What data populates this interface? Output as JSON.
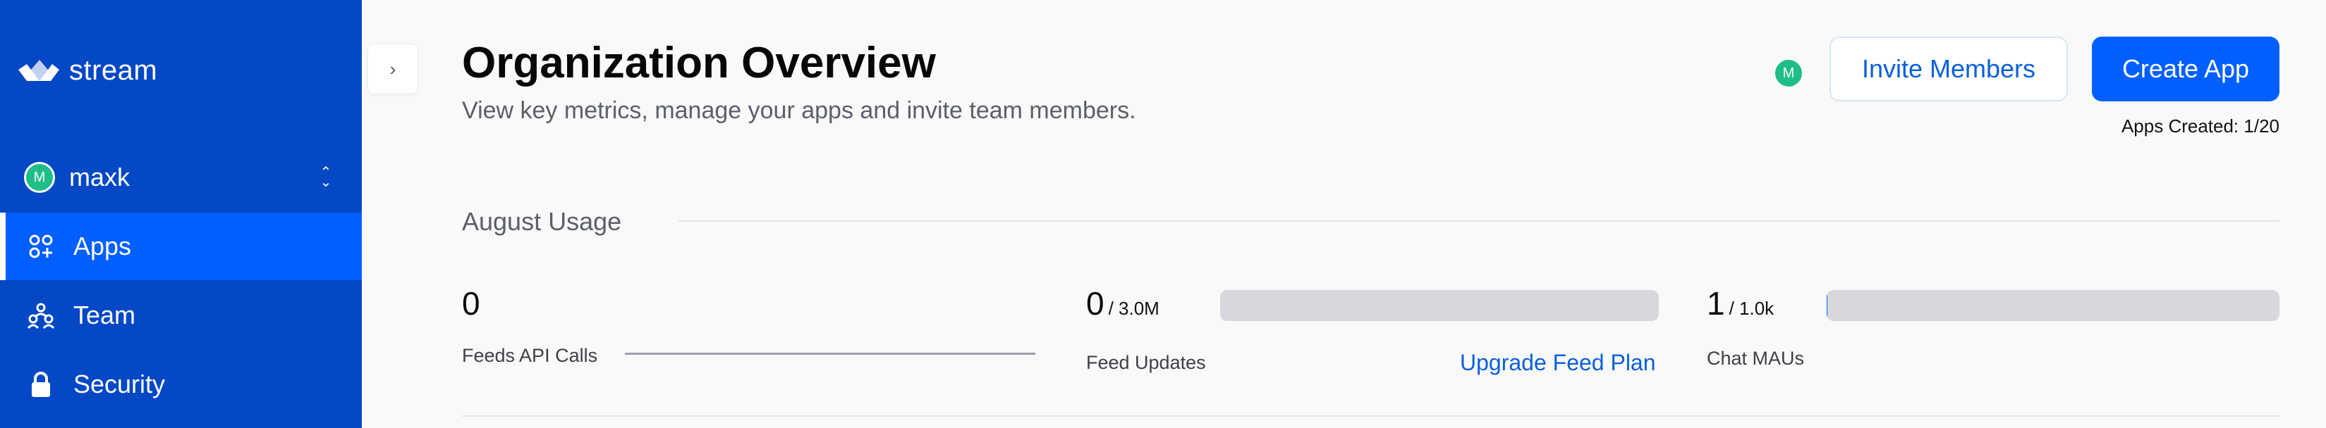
{
  "sidebar": {
    "brand": "stream",
    "org": {
      "initial": "M",
      "name": "maxk"
    },
    "items": [
      {
        "label": "Apps",
        "icon": "apps-icon",
        "active": true
      },
      {
        "label": "Team",
        "icon": "team-icon",
        "active": false
      },
      {
        "label": "Security",
        "icon": "lock-icon",
        "active": false
      }
    ]
  },
  "header": {
    "title": "Organization Overview",
    "subtitle": "View key metrics, manage your apps and invite team members.",
    "user_initial": "M",
    "invite_label": "Invite Members",
    "create_label": "Create App",
    "apps_created": "Apps Created: 1/20"
  },
  "usage": {
    "title": "August Usage",
    "metrics": [
      {
        "value": "0",
        "limit": "",
        "label": "Feeds API Calls"
      },
      {
        "value": "0",
        "limit": "/ 3.0M",
        "label": "Feed Updates",
        "fill": 0,
        "link": "Upgrade Feed Plan"
      },
      {
        "value": "1",
        "limit": "/ 1.0k",
        "label": "Chat MAUs",
        "fill": 0.001
      }
    ]
  },
  "colors": {
    "sidebar_bg": "#0448c6",
    "accent": "#005fff",
    "link": "#0b5fdc",
    "avatar": "#1fbd8a"
  }
}
